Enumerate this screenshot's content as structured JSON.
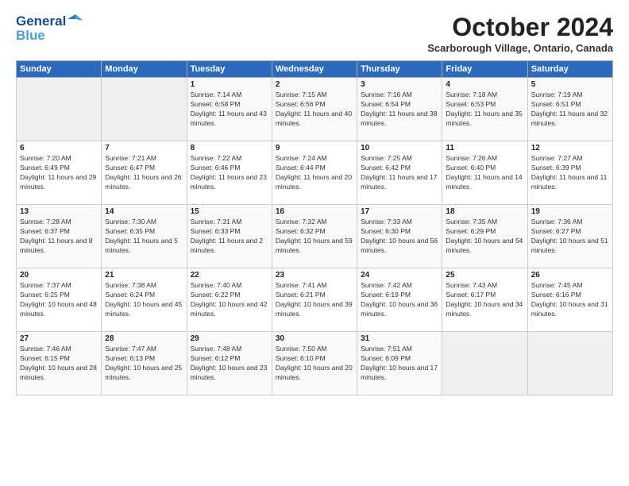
{
  "header": {
    "logo_line1": "General",
    "logo_line2": "Blue",
    "month": "October 2024",
    "location": "Scarborough Village, Ontario, Canada"
  },
  "days_of_week": [
    "Sunday",
    "Monday",
    "Tuesday",
    "Wednesday",
    "Thursday",
    "Friday",
    "Saturday"
  ],
  "weeks": [
    [
      {
        "day": "",
        "info": ""
      },
      {
        "day": "",
        "info": ""
      },
      {
        "day": "1",
        "info": "Sunrise: 7:14 AM\nSunset: 6:58 PM\nDaylight: 11 hours and 43 minutes."
      },
      {
        "day": "2",
        "info": "Sunrise: 7:15 AM\nSunset: 6:56 PM\nDaylight: 11 hours and 40 minutes."
      },
      {
        "day": "3",
        "info": "Sunrise: 7:16 AM\nSunset: 6:54 PM\nDaylight: 11 hours and 38 minutes."
      },
      {
        "day": "4",
        "info": "Sunrise: 7:18 AM\nSunset: 6:53 PM\nDaylight: 11 hours and 35 minutes."
      },
      {
        "day": "5",
        "info": "Sunrise: 7:19 AM\nSunset: 6:51 PM\nDaylight: 11 hours and 32 minutes."
      }
    ],
    [
      {
        "day": "6",
        "info": "Sunrise: 7:20 AM\nSunset: 6:49 PM\nDaylight: 11 hours and 29 minutes."
      },
      {
        "day": "7",
        "info": "Sunrise: 7:21 AM\nSunset: 6:47 PM\nDaylight: 11 hours and 26 minutes."
      },
      {
        "day": "8",
        "info": "Sunrise: 7:22 AM\nSunset: 6:46 PM\nDaylight: 11 hours and 23 minutes."
      },
      {
        "day": "9",
        "info": "Sunrise: 7:24 AM\nSunset: 6:44 PM\nDaylight: 11 hours and 20 minutes."
      },
      {
        "day": "10",
        "info": "Sunrise: 7:25 AM\nSunset: 6:42 PM\nDaylight: 11 hours and 17 minutes."
      },
      {
        "day": "11",
        "info": "Sunrise: 7:26 AM\nSunset: 6:40 PM\nDaylight: 11 hours and 14 minutes."
      },
      {
        "day": "12",
        "info": "Sunrise: 7:27 AM\nSunset: 6:39 PM\nDaylight: 11 hours and 11 minutes."
      }
    ],
    [
      {
        "day": "13",
        "info": "Sunrise: 7:28 AM\nSunset: 6:37 PM\nDaylight: 11 hours and 8 minutes."
      },
      {
        "day": "14",
        "info": "Sunrise: 7:30 AM\nSunset: 6:35 PM\nDaylight: 11 hours and 5 minutes."
      },
      {
        "day": "15",
        "info": "Sunrise: 7:31 AM\nSunset: 6:33 PM\nDaylight: 11 hours and 2 minutes."
      },
      {
        "day": "16",
        "info": "Sunrise: 7:32 AM\nSunset: 6:32 PM\nDaylight: 10 hours and 59 minutes."
      },
      {
        "day": "17",
        "info": "Sunrise: 7:33 AM\nSunset: 6:30 PM\nDaylight: 10 hours and 56 minutes."
      },
      {
        "day": "18",
        "info": "Sunrise: 7:35 AM\nSunset: 6:29 PM\nDaylight: 10 hours and 54 minutes."
      },
      {
        "day": "19",
        "info": "Sunrise: 7:36 AM\nSunset: 6:27 PM\nDaylight: 10 hours and 51 minutes."
      }
    ],
    [
      {
        "day": "20",
        "info": "Sunrise: 7:37 AM\nSunset: 6:25 PM\nDaylight: 10 hours and 48 minutes."
      },
      {
        "day": "21",
        "info": "Sunrise: 7:38 AM\nSunset: 6:24 PM\nDaylight: 10 hours and 45 minutes."
      },
      {
        "day": "22",
        "info": "Sunrise: 7:40 AM\nSunset: 6:22 PM\nDaylight: 10 hours and 42 minutes."
      },
      {
        "day": "23",
        "info": "Sunrise: 7:41 AM\nSunset: 6:21 PM\nDaylight: 10 hours and 39 minutes."
      },
      {
        "day": "24",
        "info": "Sunrise: 7:42 AM\nSunset: 6:19 PM\nDaylight: 10 hours and 36 minutes."
      },
      {
        "day": "25",
        "info": "Sunrise: 7:43 AM\nSunset: 6:17 PM\nDaylight: 10 hours and 34 minutes."
      },
      {
        "day": "26",
        "info": "Sunrise: 7:45 AM\nSunset: 6:16 PM\nDaylight: 10 hours and 31 minutes."
      }
    ],
    [
      {
        "day": "27",
        "info": "Sunrise: 7:46 AM\nSunset: 6:15 PM\nDaylight: 10 hours and 28 minutes."
      },
      {
        "day": "28",
        "info": "Sunrise: 7:47 AM\nSunset: 6:13 PM\nDaylight: 10 hours and 25 minutes."
      },
      {
        "day": "29",
        "info": "Sunrise: 7:48 AM\nSunset: 6:12 PM\nDaylight: 10 hours and 23 minutes."
      },
      {
        "day": "30",
        "info": "Sunrise: 7:50 AM\nSunset: 6:10 PM\nDaylight: 10 hours and 20 minutes."
      },
      {
        "day": "31",
        "info": "Sunrise: 7:51 AM\nSunset: 6:09 PM\nDaylight: 10 hours and 17 minutes."
      },
      {
        "day": "",
        "info": ""
      },
      {
        "day": "",
        "info": ""
      }
    ]
  ]
}
